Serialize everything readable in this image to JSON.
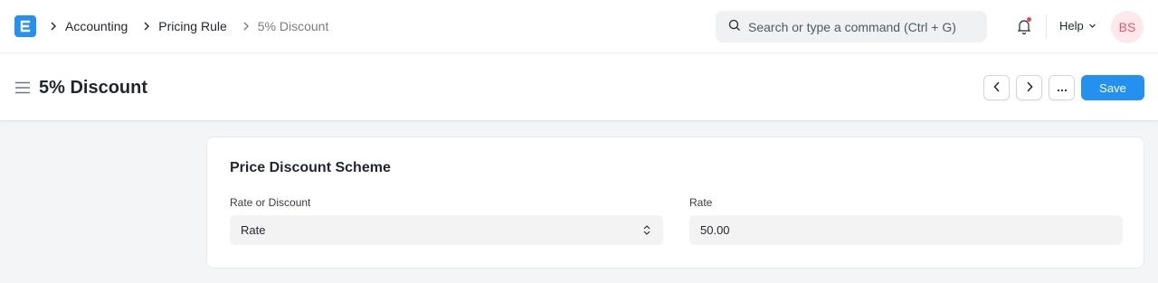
{
  "navbar": {
    "breadcrumbs": [
      "Accounting",
      "Pricing Rule",
      "5% Discount"
    ],
    "search_placeholder": "Search or type a command (Ctrl + G)",
    "help_label": "Help",
    "avatar_initials": "BS"
  },
  "page": {
    "title": "5% Discount",
    "save_label": "Save"
  },
  "section": {
    "title": "Price Discount Scheme",
    "fields": [
      {
        "label": "Rate or Discount",
        "value": "Rate",
        "type": "select"
      },
      {
        "label": "Rate",
        "value": "50.00",
        "type": "input"
      }
    ]
  },
  "colors": {
    "accent": "#2490ef",
    "notification_dot": "#e24c4c",
    "avatar_bg": "#fde8ec",
    "avatar_text": "#e8546e"
  }
}
